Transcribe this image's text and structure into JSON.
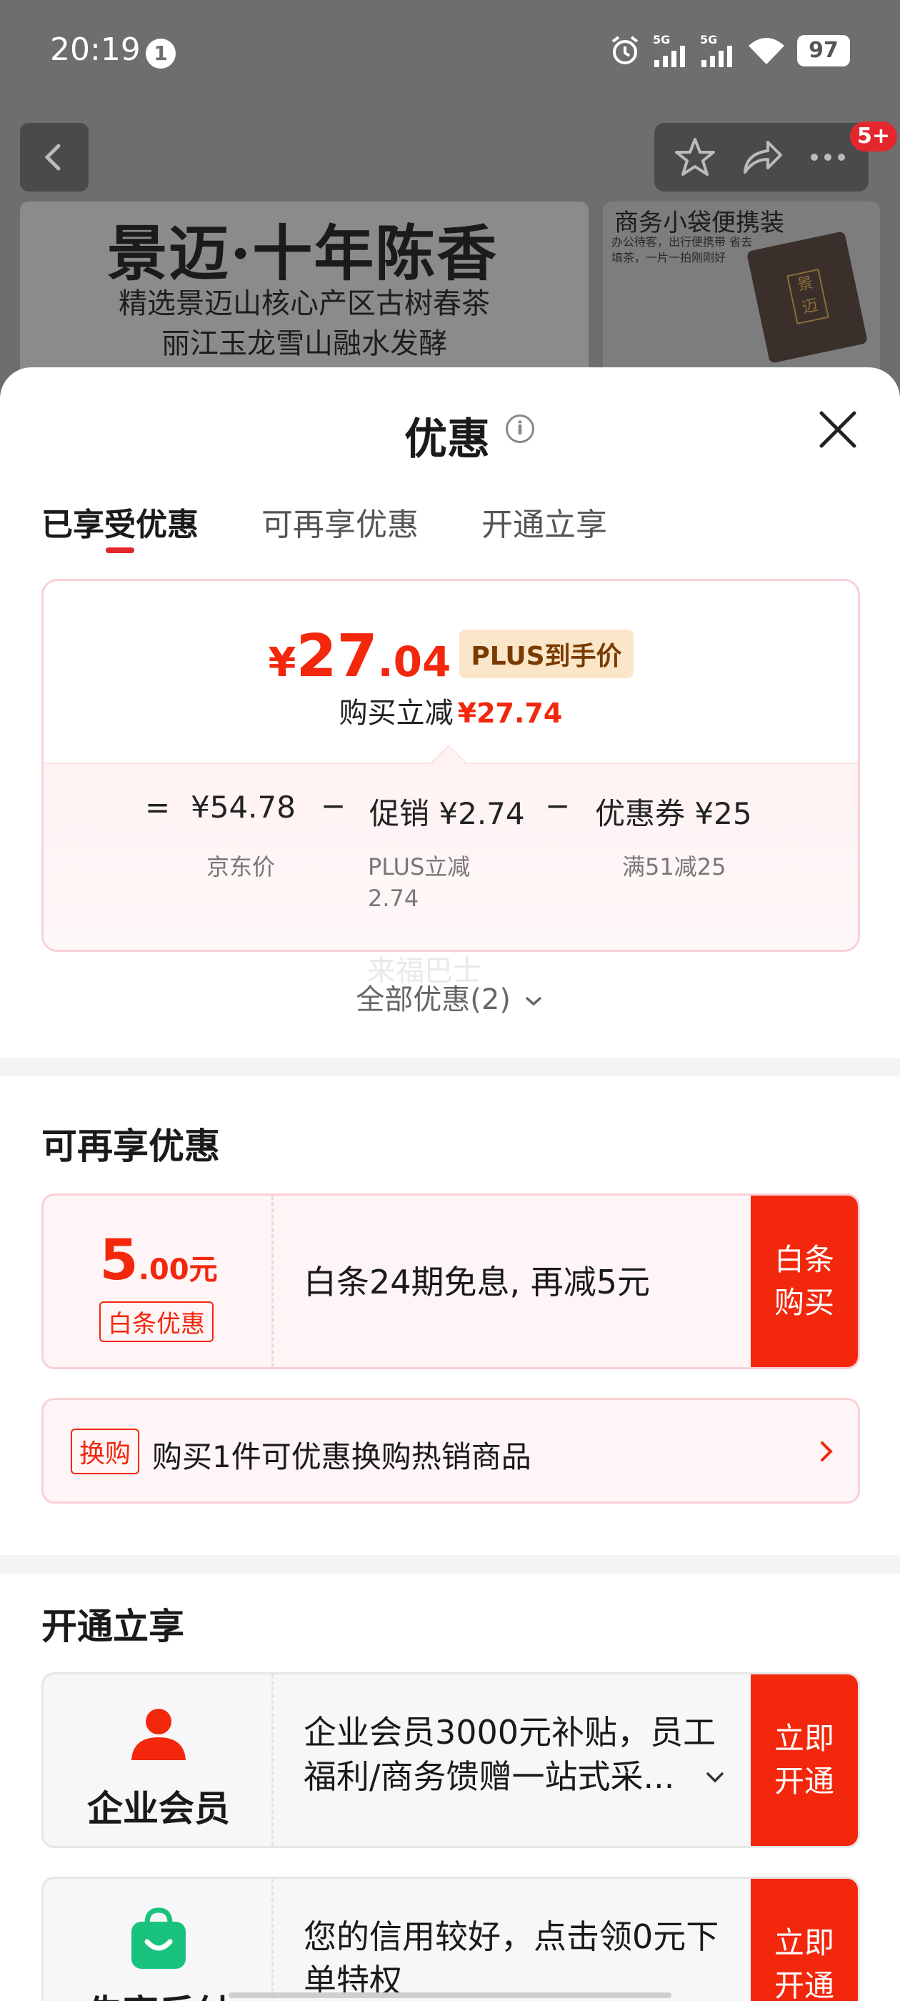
{
  "status_bar": {
    "time": "20:19",
    "notification_count": "1",
    "signal_1_label": "5G",
    "signal_2_label": "5G",
    "battery": "97"
  },
  "nav": {
    "badge": "5+",
    "icons": [
      "back-icon",
      "star-icon",
      "share-icon",
      "more-icon"
    ]
  },
  "banner": {
    "title": "景迈·十年陈香",
    "line1": "精选景迈山核心产区古树春茶",
    "line2": "丽江玉龙雪山融水发酵",
    "side_title": "商务小袋便携装",
    "side_sub": "办公待客，出行便携带 省去填茶，一片一拍刚刚好",
    "bag_label": "景迈"
  },
  "sheet": {
    "title": "优惠",
    "tabs": [
      {
        "label": "已享受优惠",
        "active": true
      },
      {
        "label": "可再享优惠",
        "active": false
      },
      {
        "label": "开通立享",
        "active": false
      }
    ]
  },
  "price_card": {
    "currency": "¥",
    "price_int": "27",
    "price_dec": ".04",
    "price_tag": "PLUS到手价",
    "sub_label": "购买立减",
    "sub_value": "¥27.74",
    "breakdown": {
      "eq": "=",
      "base_price": "¥54.78",
      "minus": "−",
      "promo_label": "促销",
      "promo_value": "¥2.74",
      "coupon_label": "优惠券",
      "coupon_value": "¥25",
      "base_note": "京东价",
      "promo_note": "PLUS立减 2.74",
      "coupon_note": "满51减25"
    }
  },
  "all_promos": "全部优惠(2)",
  "ghost_text": "来福巴士",
  "section_more": {
    "title": "可再享优惠",
    "coupon": {
      "amount_big": "5",
      "amount_small": ".00元",
      "tag": "白条优惠",
      "desc": "白条24期免息, 再减5元",
      "button": "白条购买"
    },
    "swap": {
      "tag": "换购",
      "text": "购买1件可优惠换购热销商品"
    }
  },
  "section_open": {
    "title": "开通立享",
    "items": [
      {
        "name": "企业会员",
        "desc": "企业会员3000元补贴，员工福利/商务馈赠一站式采...",
        "button": "立即开通",
        "icon": "person-icon",
        "icon_color": "#f2270c"
      },
      {
        "name": "先享后付",
        "desc": "您的信用较好，点击领0元下单特权",
        "button": "立即开通",
        "icon": "shopping-bag-icon",
        "icon_color": "#19c37d"
      }
    ]
  },
  "colors": {
    "accent": "#f2270c",
    "card_border": "#f9d0d5",
    "card_bg": "#fff5f6",
    "plus_tag_bg": "#fbe6c9"
  }
}
